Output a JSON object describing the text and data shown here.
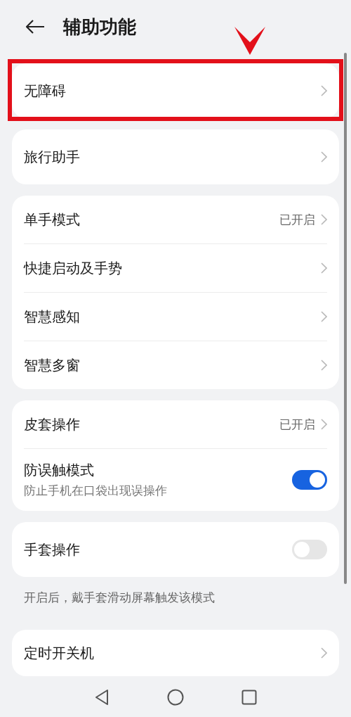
{
  "header": {
    "title": "辅助功能"
  },
  "groups": [
    {
      "highlighted": true,
      "items": [
        {
          "kind": "link",
          "label": "无障碍"
        }
      ]
    },
    {
      "highlighted": false,
      "items": [
        {
          "kind": "link",
          "label": "旅行助手"
        }
      ]
    },
    {
      "highlighted": false,
      "items": [
        {
          "kind": "link",
          "label": "单手模式",
          "value": "已开启"
        },
        {
          "kind": "link",
          "label": "快捷启动及手势"
        },
        {
          "kind": "link",
          "label": "智慧感知"
        },
        {
          "kind": "link",
          "label": "智慧多窗"
        }
      ]
    },
    {
      "highlighted": false,
      "items": [
        {
          "kind": "link",
          "label": "皮套操作",
          "value": "已开启"
        },
        {
          "kind": "toggle",
          "label": "防误触模式",
          "subtitle": "防止手机在口袋出现误操作",
          "on": true
        }
      ]
    },
    {
      "highlighted": false,
      "items": [
        {
          "kind": "toggle",
          "label": "手套操作",
          "on": false
        }
      ],
      "footnote": "开启后，戴手套滑动屏幕触发该模式"
    },
    {
      "highlighted": false,
      "items": [
        {
          "kind": "link",
          "label": "定时开关机"
        }
      ]
    }
  ]
}
